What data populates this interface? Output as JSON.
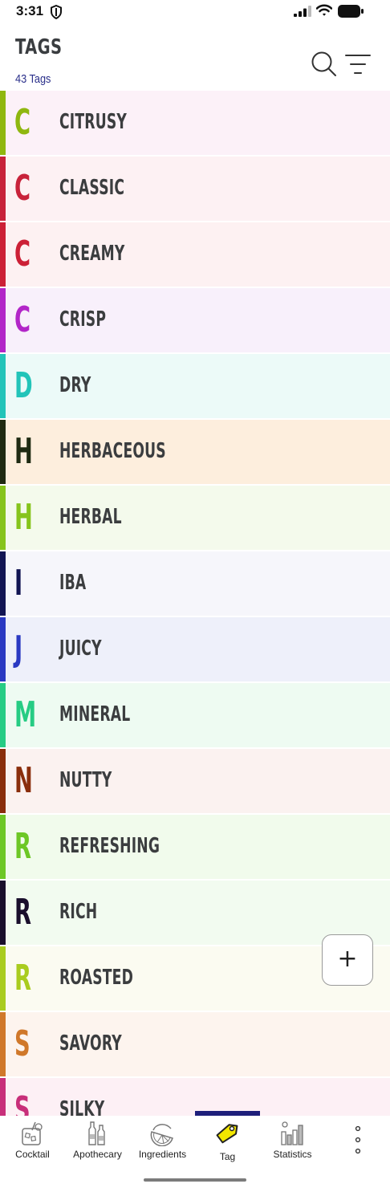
{
  "status_bar": {
    "time": "3:31"
  },
  "header": {
    "title": "TAGS",
    "count": "43 Tags"
  },
  "tags": [
    {
      "letter": "C",
      "name": "CITRUSY",
      "color": "#8fb70f",
      "bg": "#fcf1f8"
    },
    {
      "letter": "C",
      "name": "CLASSIC",
      "color": "#c8223a",
      "bg": "#fdf1f3"
    },
    {
      "letter": "C",
      "name": "CREAMY",
      "color": "#cc2036",
      "bg": "#fdf1f2"
    },
    {
      "letter": "C",
      "name": "CRISP",
      "color": "#b226c8",
      "bg": "#f8f0fb"
    },
    {
      "letter": "D",
      "name": "DRY",
      "color": "#22c4b9",
      "bg": "#ecfaf8"
    },
    {
      "letter": "H",
      "name": "HERBACEOUS",
      "color": "#1f2a12",
      "bg": "#fdeedd"
    },
    {
      "letter": "H",
      "name": "HERBAL",
      "color": "#86c41c",
      "bg": "#f4faec"
    },
    {
      "letter": "I",
      "name": "IBA",
      "color": "#121553",
      "bg": "#f6f6fb"
    },
    {
      "letter": "J",
      "name": "JUICY",
      "color": "#2a39c2",
      "bg": "#eef0fa"
    },
    {
      "letter": "M",
      "name": "MINERAL",
      "color": "#26cc84",
      "bg": "#eefbf2"
    },
    {
      "letter": "N",
      "name": "NUTTY",
      "color": "#8a2e0c",
      "bg": "#fbf2f0"
    },
    {
      "letter": "R",
      "name": "REFRESHING",
      "color": "#6dc726",
      "bg": "#f1fbec"
    },
    {
      "letter": "R",
      "name": "RICH",
      "color": "#1a0f2c",
      "bg": "#f2fbf0"
    },
    {
      "letter": "R",
      "name": "ROASTED",
      "color": "#a9cc1f",
      "bg": "#fbfbf1"
    },
    {
      "letter": "S",
      "name": "SAVORY",
      "color": "#d0782a",
      "bg": "#fdf4ee"
    },
    {
      "letter": "S",
      "name": "SILKY",
      "color": "#c82f7a",
      "bg": "#fdf0f5"
    }
  ],
  "fab": {
    "icon": "plus-icon",
    "label": "+"
  },
  "bottom_nav": {
    "active": "Tag",
    "active_color": "#1e1e7a",
    "items": [
      {
        "label": "Cocktail",
        "icon": "cocktail-glass-icon"
      },
      {
        "label": "Apothecary",
        "icon": "bottles-icon"
      },
      {
        "label": "Ingredients",
        "icon": "lime-slice-icon"
      },
      {
        "label": "Tag",
        "icon": "tag-icon"
      },
      {
        "label": "Statistics",
        "icon": "bar-chart-icon"
      }
    ],
    "more_icon": "more-vertical-icon"
  }
}
